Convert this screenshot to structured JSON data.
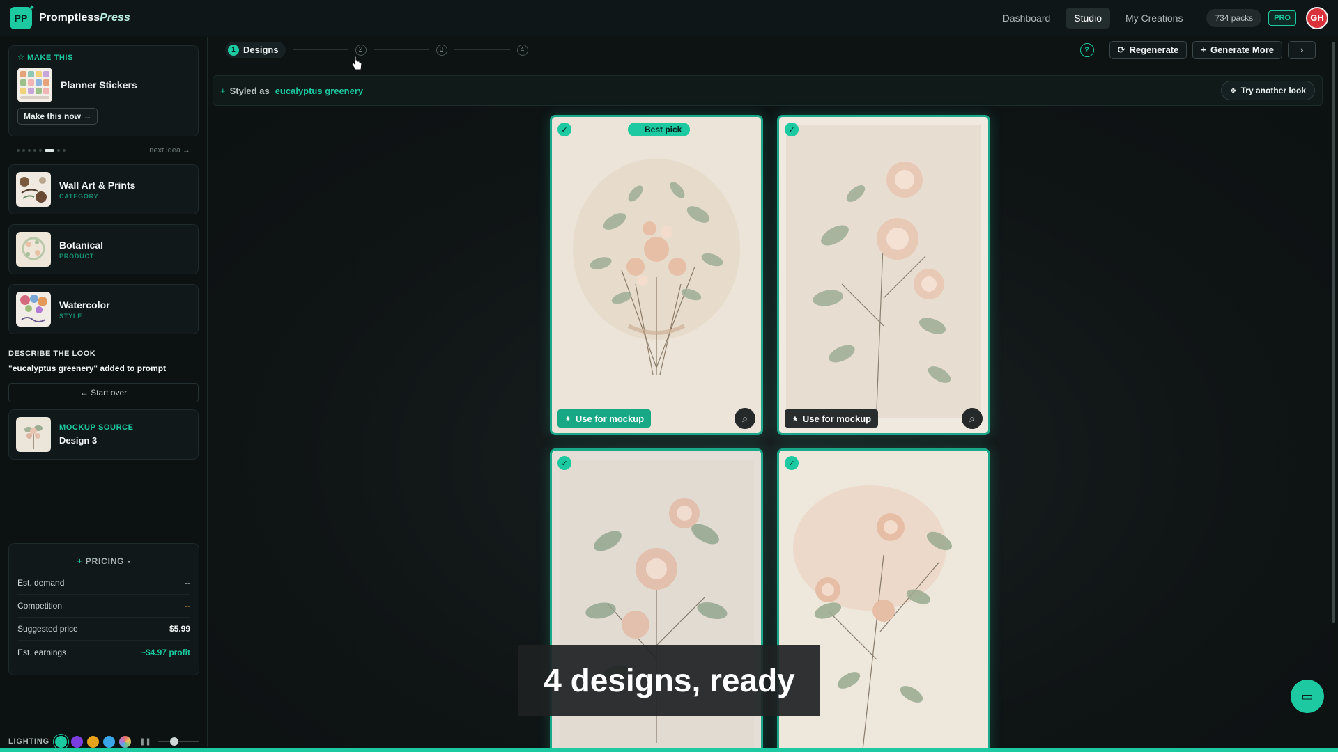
{
  "app": {
    "logo": "PP",
    "brand_main": "Promptless",
    "brand_accent": "Press",
    "accent_color": "#1cc9a0"
  },
  "nav": {
    "items": [
      {
        "label": "Dashboard",
        "active": false
      },
      {
        "label": "Studio",
        "active": true
      },
      {
        "label": "My Creations",
        "active": false
      }
    ],
    "packs": "734 packs",
    "pro": "PRO",
    "avatar": "GH"
  },
  "sidebar": {
    "make_this": {
      "label": "MAKE THIS",
      "title": "Planner Stickers",
      "button": "Make this now →"
    },
    "next_idea": "next idea →",
    "categories": [
      {
        "title": "Wall Art & Prints",
        "sub": "CATEGORY"
      },
      {
        "title": "Botanical",
        "sub": "PRODUCT"
      },
      {
        "title": "Watercolor",
        "sub": "STYLE"
      }
    ],
    "describe": {
      "label": "DESCRIBE THE LOOK",
      "text": "\"eucalyptus greenery\" added to prompt"
    },
    "start_over": "← Start over",
    "mockup": {
      "label": "MOCKUP SOURCE",
      "value": "Design 3"
    },
    "pricing": {
      "title": "PRICING",
      "rows": [
        {
          "label": "Est. demand",
          "value": "--"
        },
        {
          "label": "Competition",
          "value": "--"
        },
        {
          "label": "Suggested price",
          "value": "$5.99"
        },
        {
          "label": "Est. earnings",
          "value": "~$4.97 profit"
        }
      ]
    },
    "lighting": {
      "label": "LIGHTING",
      "swatches": [
        "#1cc9a0",
        "#7b3fe0",
        "#e8a31c",
        "#3aa6e8",
        "#9ac07a"
      ],
      "level": 0.4
    }
  },
  "steps": {
    "items": [
      {
        "num": "1",
        "label": "Designs"
      },
      {
        "num": "2"
      },
      {
        "num": "3"
      },
      {
        "num": "4"
      }
    ],
    "help": "?",
    "regenerate": "Regenerate",
    "generate_more": "Generate More"
  },
  "banner": {
    "label": "Styled as",
    "value": "eucalyptus greenery",
    "try_another": "Try another look"
  },
  "designs": [
    {
      "best_pick": "Best pick",
      "use_label": "Use for mockup",
      "selected_for_mockup": true
    },
    {
      "use_label": "Use for mockup",
      "selected_for_mockup": false
    },
    {},
    {}
  ],
  "caption": "4 designs, ready"
}
